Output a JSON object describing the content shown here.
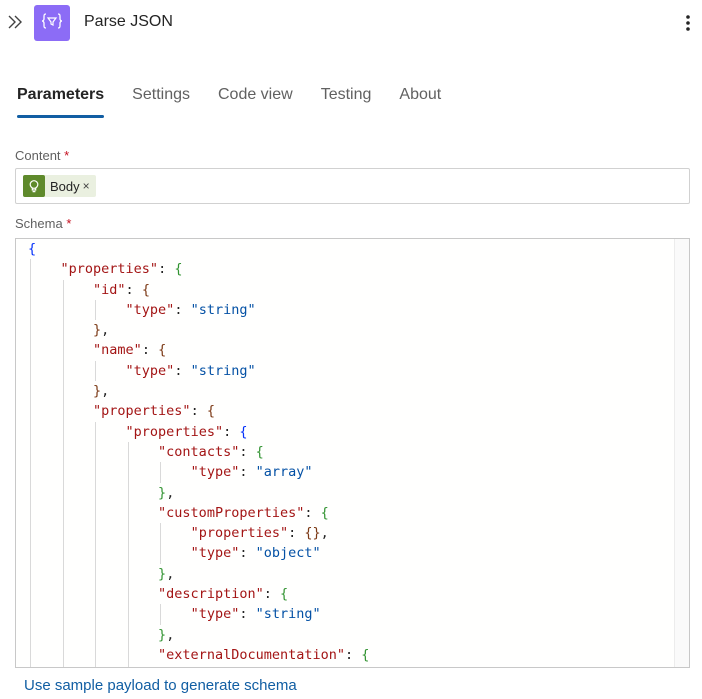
{
  "header": {
    "title": "Parse JSON",
    "collapse_icon": "double-chevron-right-icon",
    "app_icon": "curly-braces-filter-icon",
    "more_icon": "more-vertical-icon",
    "app_icon_color": "#8c6cf6"
  },
  "tabs": [
    {
      "label": "Parameters",
      "active": true
    },
    {
      "label": "Settings",
      "active": false
    },
    {
      "label": "Code view",
      "active": false
    },
    {
      "label": "Testing",
      "active": false
    },
    {
      "label": "About",
      "active": false
    }
  ],
  "content": {
    "label": "Content",
    "required_mark": "*",
    "token": {
      "label": "Body",
      "remove": "×",
      "icon": "lightbulb-icon",
      "color": "#5f8a2c"
    }
  },
  "schema": {
    "label": "Schema",
    "required_mark": "*",
    "lines": [
      "{",
      "    \"properties\": {",
      "        \"id\": {",
      "            \"type\": \"string\"",
      "        },",
      "        \"name\": {",
      "            \"type\": \"string\"",
      "        },",
      "        \"properties\": {",
      "            \"properties\": {",
      "                \"contacts\": {",
      "                    \"type\": \"array\"",
      "                },",
      "                \"customProperties\": {",
      "                    \"properties\": {},",
      "                    \"type\": \"object\"",
      "                },",
      "                \"description\": {",
      "                    \"type\": \"string\"",
      "                },",
      "                \"externalDocumentation\": {"
    ]
  },
  "footer": {
    "link": "Use sample payload to generate schema"
  },
  "colors": {
    "accent": "#115ea3",
    "required": "#c50f1f",
    "json_key": "#a31515",
    "json_string": "#0451a5"
  }
}
